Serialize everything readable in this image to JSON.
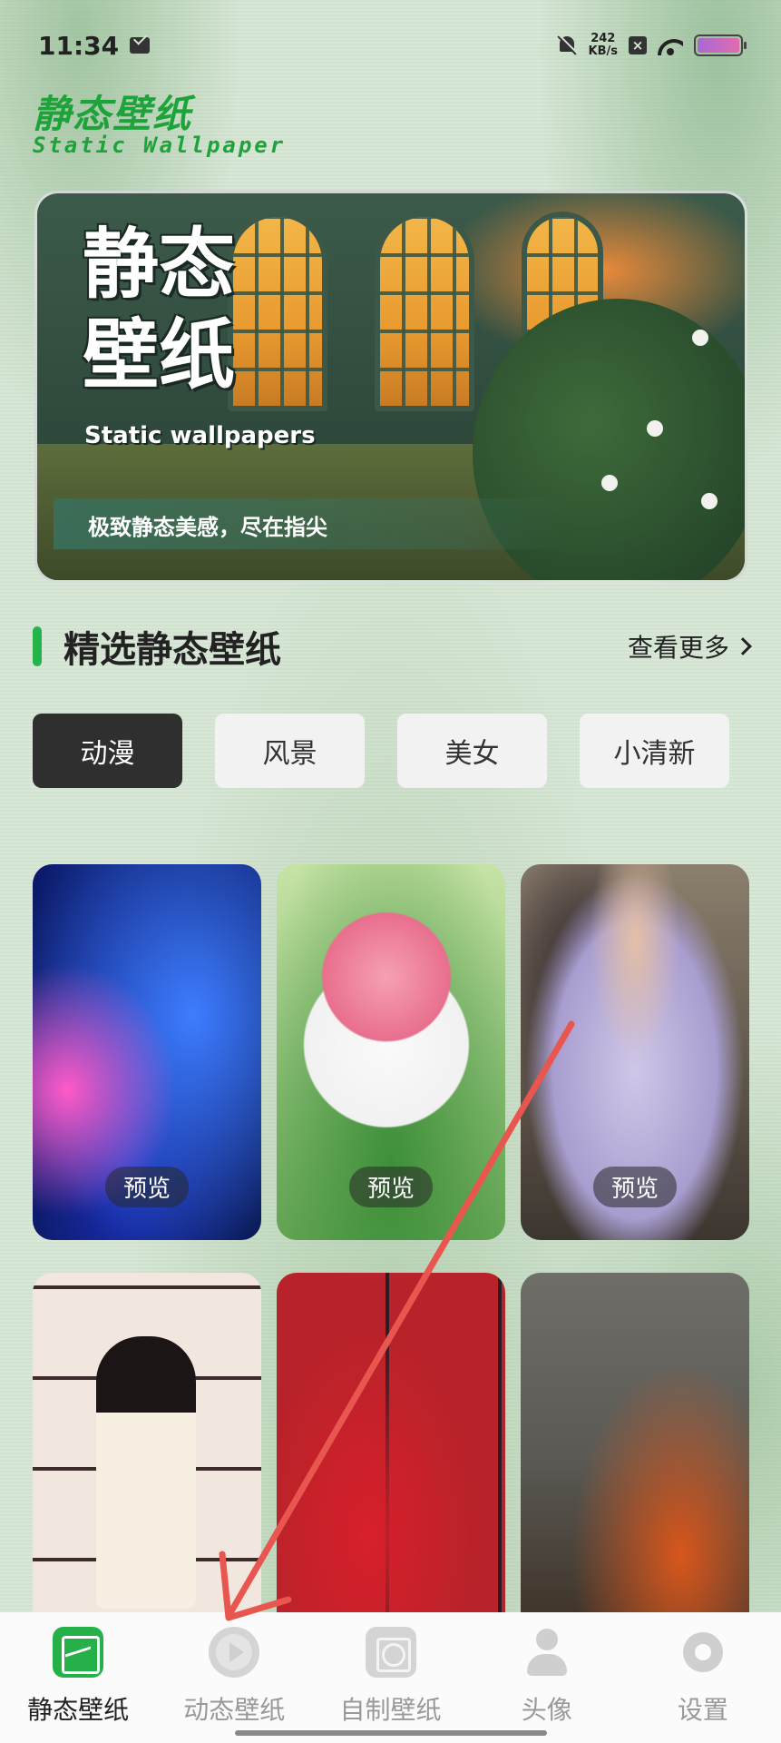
{
  "status_bar": {
    "time": "11:34",
    "net_speed_value": "242",
    "net_speed_unit": "KB/s"
  },
  "header": {
    "title": "静态壁纸",
    "subtitle": "Static Wallpaper"
  },
  "banner": {
    "title": "静态壁纸",
    "subtitle": "Static wallpapers",
    "tagline": "极致静态美感，尽在指尖"
  },
  "section": {
    "title": "精选静态壁纸",
    "more_label": "查看更多"
  },
  "category_tabs": [
    {
      "label": "动漫",
      "active": true
    },
    {
      "label": "风景",
      "active": false
    },
    {
      "label": "美女",
      "active": false
    },
    {
      "label": "小清新",
      "active": false
    }
  ],
  "wallpapers": [
    {
      "preview_label": "预览"
    },
    {
      "preview_label": "预览"
    },
    {
      "preview_label": "预览"
    },
    {
      "preview_label": ""
    },
    {
      "preview_label": ""
    },
    {
      "preview_label": ""
    }
  ],
  "bottom_nav": [
    {
      "label": "静态壁纸",
      "icon": "wallpaper-icon",
      "active": true
    },
    {
      "label": "动态壁纸",
      "icon": "play-icon",
      "active": false
    },
    {
      "label": "自制壁纸",
      "icon": "custom-icon",
      "active": false
    },
    {
      "label": "头像",
      "icon": "avatar-icon",
      "active": false
    },
    {
      "label": "设置",
      "icon": "gear-icon",
      "active": false
    }
  ],
  "colors": {
    "accent": "#1ea33b",
    "active_tab": "#2f2f2f",
    "annotation_arrow": "#e8564f"
  }
}
